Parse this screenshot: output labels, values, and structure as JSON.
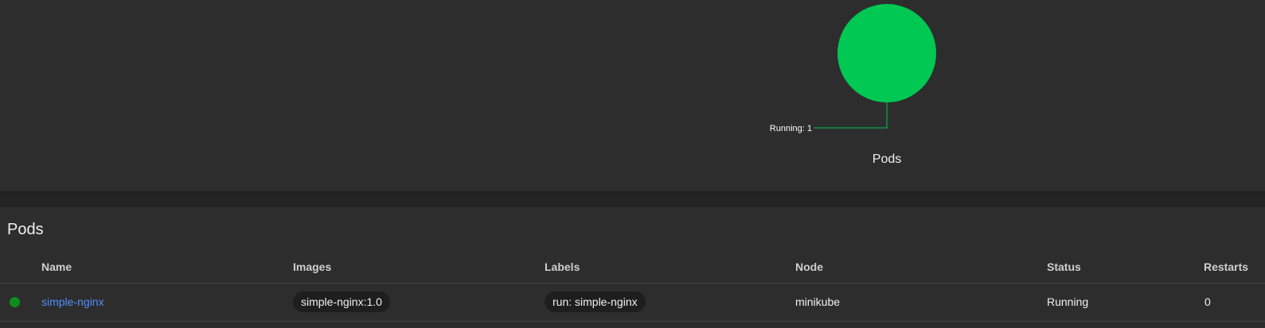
{
  "chart": {
    "title": "Pods",
    "label": "Running: 1",
    "color": "#00c853"
  },
  "chart_data": {
    "type": "pie",
    "title": "Pods",
    "slices": [
      {
        "label": "Running",
        "value": 1,
        "color": "#00c853"
      }
    ]
  },
  "pods_table": {
    "title": "Pods",
    "columns": [
      "Name",
      "Images",
      "Labels",
      "Node",
      "Status",
      "Restarts"
    ],
    "rows": [
      {
        "status_color": "#0a8f1d",
        "name": "simple-nginx",
        "image": "simple-nginx:1.0",
        "label": "run: simple-nginx",
        "node": "minikube",
        "status": "Running",
        "restarts": "0"
      }
    ]
  }
}
